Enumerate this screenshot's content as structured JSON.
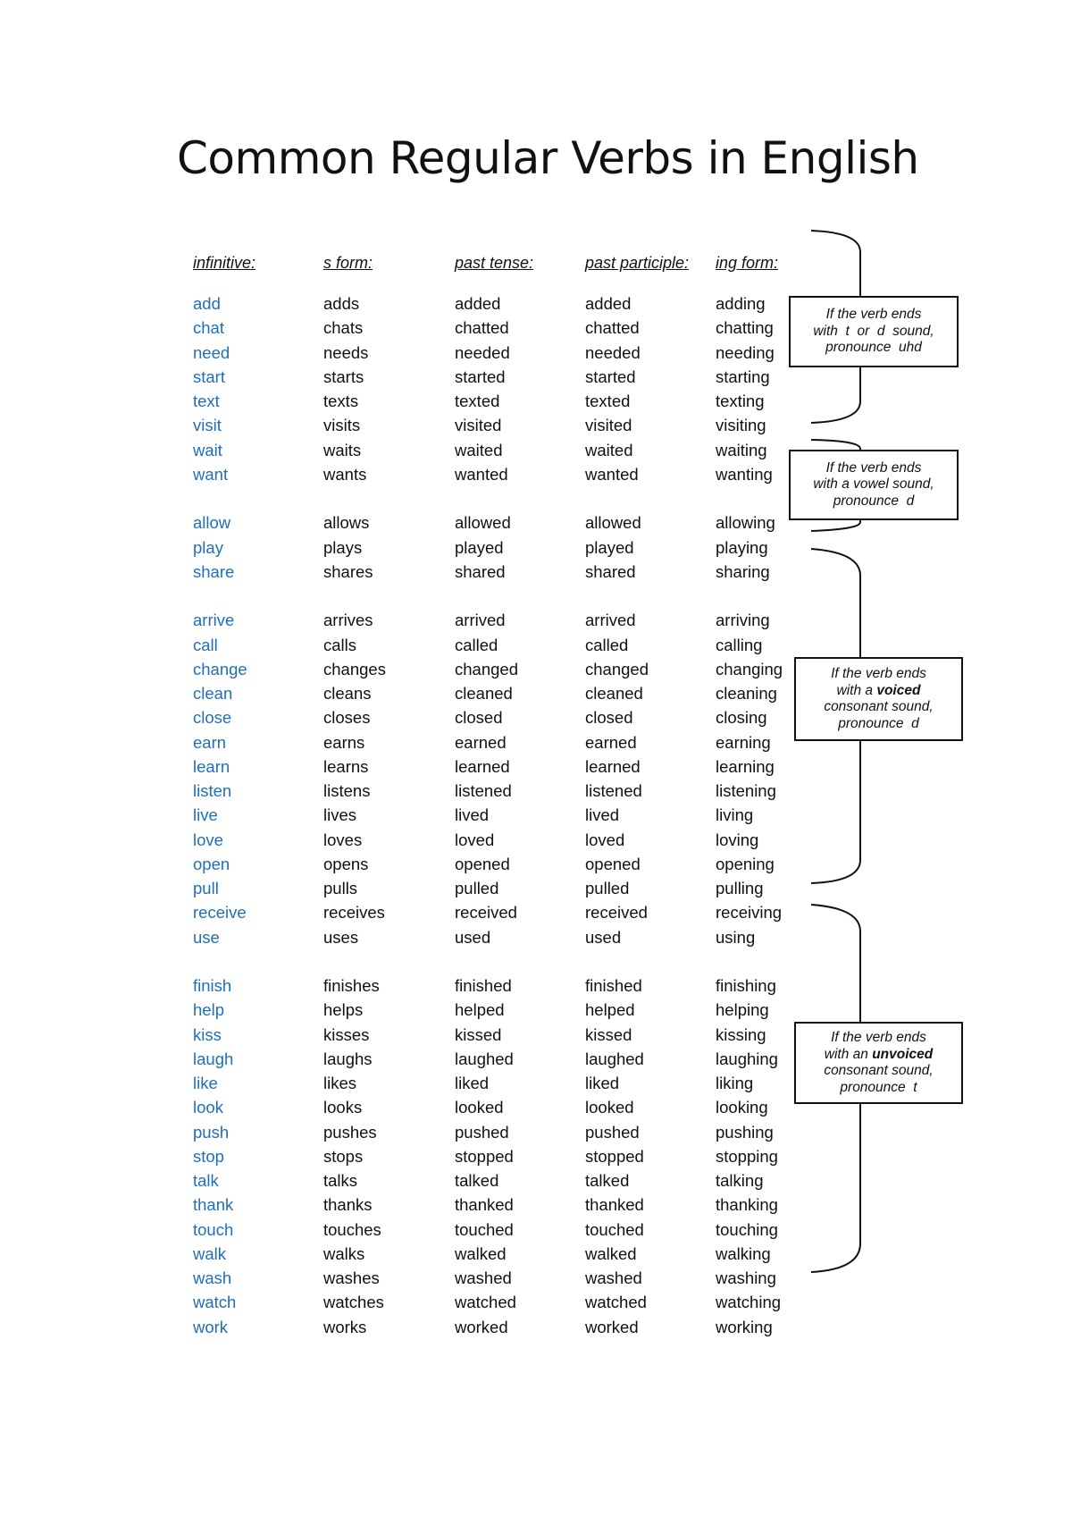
{
  "title": "Common Regular Verbs in English",
  "headers": [
    "infinitive:",
    "s form:",
    "past tense:",
    "past participle:",
    "ing form:"
  ],
  "colors": {
    "infinitive": "#1f6fba",
    "text": "#111111"
  },
  "groups": [
    {
      "rows": [
        [
          "add",
          "adds",
          "added",
          "added",
          "adding"
        ],
        [
          "chat",
          "chats",
          "chatted",
          "chatted",
          "chatting"
        ],
        [
          "need",
          "needs",
          "needed",
          "needed",
          "needing"
        ],
        [
          "start",
          "starts",
          "started",
          "started",
          "starting"
        ],
        [
          "text",
          "texts",
          "texted",
          "texted",
          "texting"
        ],
        [
          "visit",
          "visits",
          "visited",
          "visited",
          "visiting"
        ],
        [
          "wait",
          "waits",
          "waited",
          "waited",
          "waiting"
        ],
        [
          "want",
          "wants",
          "wanted",
          "wanted",
          "wanting"
        ]
      ]
    },
    {
      "rows": [
        [
          "allow",
          "allows",
          "allowed",
          "allowed",
          "allowing"
        ],
        [
          "play",
          "plays",
          "played",
          "played",
          "playing"
        ],
        [
          "share",
          "shares",
          "shared",
          "shared",
          "sharing"
        ]
      ]
    },
    {
      "rows": [
        [
          "arrive",
          "arrives",
          "arrived",
          "arrived",
          "arriving"
        ],
        [
          "call",
          "calls",
          "called",
          "called",
          "calling"
        ],
        [
          "change",
          "changes",
          "changed",
          "changed",
          "changing"
        ],
        [
          "clean",
          "cleans",
          "cleaned",
          "cleaned",
          "cleaning"
        ],
        [
          "close",
          "closes",
          "closed",
          "closed",
          "closing"
        ],
        [
          "earn",
          "earns",
          "earned",
          "earned",
          "earning"
        ],
        [
          "learn",
          "learns",
          "learned",
          "learned",
          "learning"
        ],
        [
          "listen",
          "listens",
          "listened",
          "listened",
          "listening"
        ],
        [
          "live",
          "lives",
          "lived",
          "lived",
          "living"
        ],
        [
          "love",
          "loves",
          "loved",
          "loved",
          "loving"
        ],
        [
          "open",
          "opens",
          "opened",
          "opened",
          "opening"
        ],
        [
          "pull",
          "pulls",
          "pulled",
          "pulled",
          "pulling"
        ],
        [
          "receive",
          "receives",
          "received",
          "received",
          "receiving"
        ],
        [
          "use",
          "uses",
          "used",
          "used",
          "using"
        ]
      ]
    },
    {
      "rows": [
        [
          "finish",
          "finishes",
          "finished",
          "finished",
          "finishing"
        ],
        [
          "help",
          "helps",
          "helped",
          "helped",
          "helping"
        ],
        [
          "kiss",
          "kisses",
          "kissed",
          "kissed",
          "kissing"
        ],
        [
          "laugh",
          "laughs",
          "laughed",
          "laughed",
          "laughing"
        ],
        [
          "like",
          "likes",
          "liked",
          "liked",
          "liking"
        ],
        [
          "look",
          "looks",
          "looked",
          "looked",
          "looking"
        ],
        [
          "push",
          "pushes",
          "pushed",
          "pushed",
          "pushing"
        ],
        [
          "stop",
          "stops",
          "stopped",
          "stopped",
          "stopping"
        ],
        [
          "talk",
          "talks",
          "talked",
          "talked",
          "talking"
        ],
        [
          "thank",
          "thanks",
          "thanked",
          "thanked",
          "thanking"
        ],
        [
          "touch",
          "touches",
          "touched",
          "touched",
          "touching"
        ],
        [
          "walk",
          "walks",
          "walked",
          "walked",
          "walking"
        ],
        [
          "wash",
          "washes",
          "washed",
          "washed",
          "washing"
        ],
        [
          "watch",
          "watches",
          "watched",
          "watched",
          "watching"
        ],
        [
          "work",
          "works",
          "worked",
          "worked",
          "working"
        ]
      ]
    }
  ],
  "notes": [
    {
      "line1": "If the verb ends",
      "line2_pre": "with  t  or  d  sound,",
      "line2_bold": "",
      "line3": "pronounce  uhd",
      "line4": ""
    },
    {
      "line1": "If the verb ends",
      "line2_pre": "with a vowel sound,",
      "line2_bold": "",
      "line3": "pronounce  d",
      "line4": ""
    },
    {
      "line1": "If the verb ends",
      "line2_pre": "with a ",
      "line2_bold": "voiced",
      "line3": "consonant sound,",
      "line4": "pronounce  d"
    },
    {
      "line1": "If the verb ends",
      "line2_pre": "with an ",
      "line2_bold": "unvoiced",
      "line3": "consonant sound,",
      "line4": "pronounce  t"
    }
  ]
}
